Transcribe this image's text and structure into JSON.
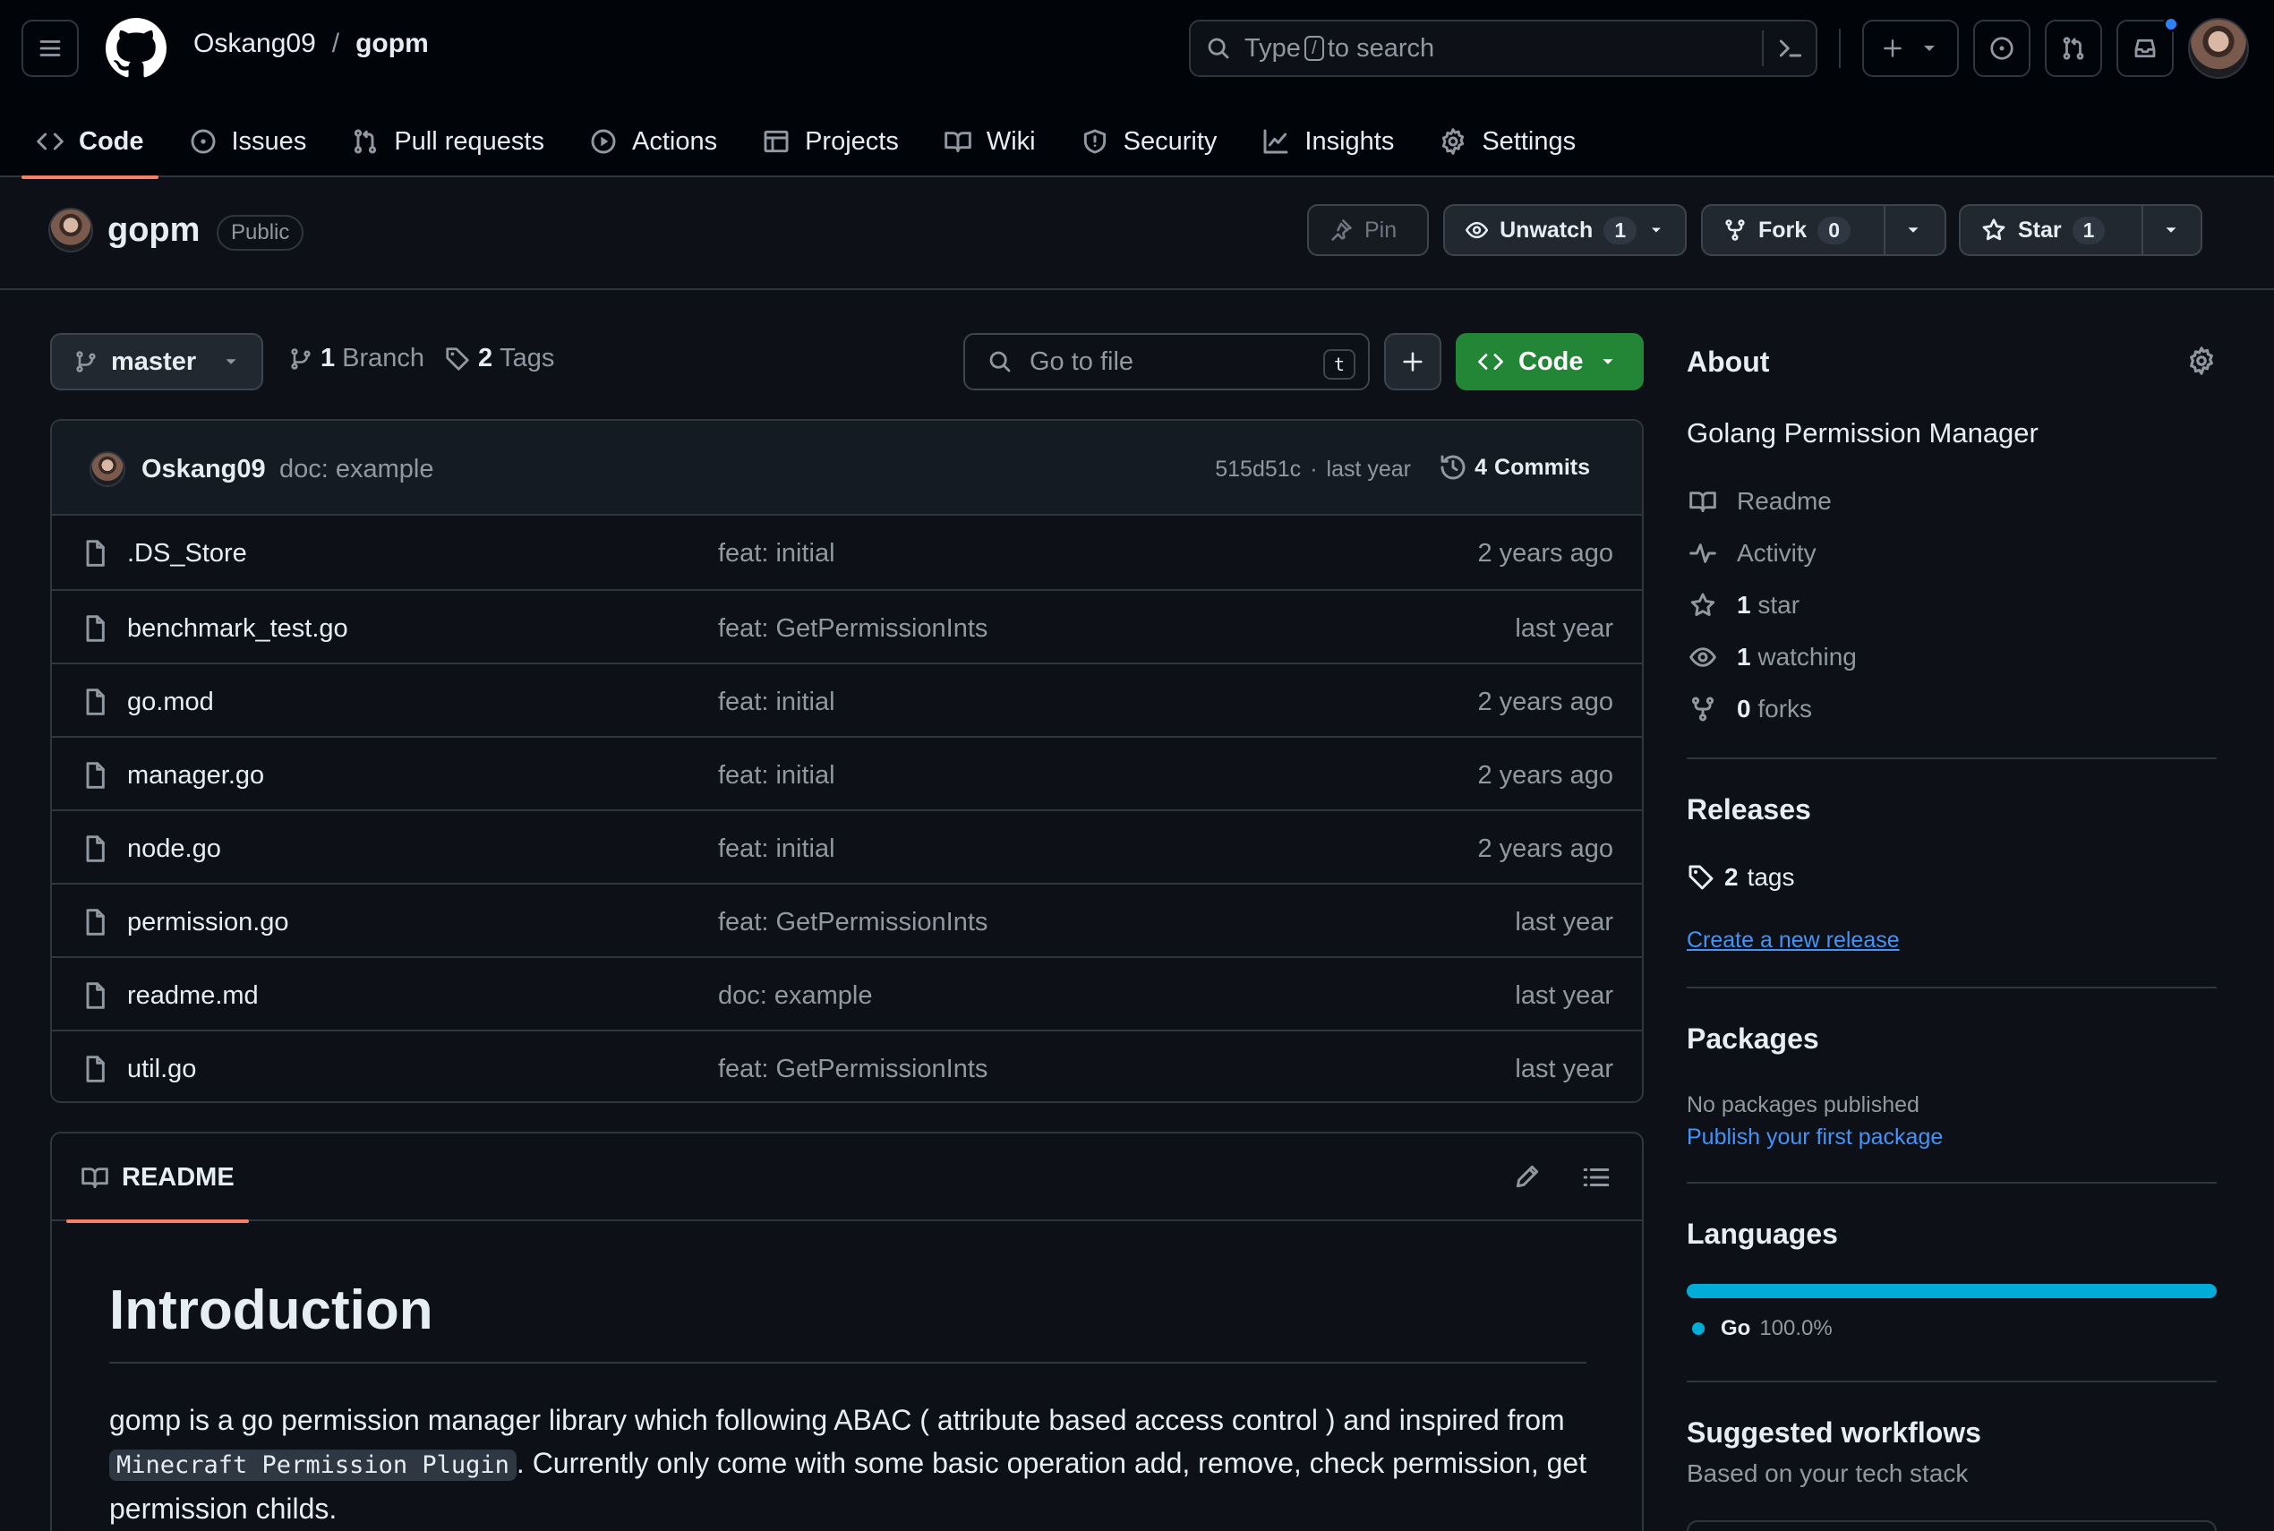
{
  "header": {
    "owner": "Oskang09",
    "separator": "/",
    "repo": "gopm",
    "search_prefix": "Type",
    "search_key": "/",
    "search_suffix": "to search"
  },
  "tabs": [
    {
      "label": "Code",
      "icon": "code-icon",
      "active": true
    },
    {
      "label": "Issues",
      "icon": "issue-icon"
    },
    {
      "label": "Pull requests",
      "icon": "pull-request-icon"
    },
    {
      "label": "Actions",
      "icon": "play-icon"
    },
    {
      "label": "Projects",
      "icon": "table-icon"
    },
    {
      "label": "Wiki",
      "icon": "book-icon"
    },
    {
      "label": "Security",
      "icon": "shield-icon"
    },
    {
      "label": "Insights",
      "icon": "graph-icon"
    },
    {
      "label": "Settings",
      "icon": "gear-icon"
    }
  ],
  "repo": {
    "name": "gopm",
    "visibility": "Public",
    "pin_label": "Pin",
    "watch_label": "Unwatch",
    "watch_count": "1",
    "fork_label": "Fork",
    "fork_count": "0",
    "star_label": "Star",
    "star_count": "1"
  },
  "toolbar": {
    "branch": "master",
    "branch_count": "1",
    "branch_label": "Branch",
    "tag_count": "2",
    "tag_label": "Tags",
    "go_to_file": "Go to file",
    "go_to_file_key": "t",
    "code_label": "Code"
  },
  "latest_commit": {
    "author": "Oskang09",
    "message": "doc: example",
    "sha": "515d51c",
    "dot": "·",
    "time": "last year",
    "commits_count": "4",
    "commits_label": "Commits"
  },
  "files": [
    {
      "name": ".DS_Store",
      "message": "feat: initial",
      "time": "2 years ago"
    },
    {
      "name": "benchmark_test.go",
      "message": "feat: GetPermissionInts",
      "time": "last year"
    },
    {
      "name": "go.mod",
      "message": "feat: initial",
      "time": "2 years ago"
    },
    {
      "name": "manager.go",
      "message": "feat: initial",
      "time": "2 years ago"
    },
    {
      "name": "node.go",
      "message": "feat: initial",
      "time": "2 years ago"
    },
    {
      "name": "permission.go",
      "message": "feat: GetPermissionInts",
      "time": "last year"
    },
    {
      "name": "readme.md",
      "message": "doc: example",
      "time": "last year"
    },
    {
      "name": "util.go",
      "message": "feat: GetPermissionInts",
      "time": "last year"
    }
  ],
  "readme": {
    "tab_label": "README",
    "title": "Introduction",
    "body_part1": "gomp is a go permission manager library which following ABAC ( attribute based access control ) and inspired from ",
    "body_code": "Minecraft Permission Plugin",
    "body_part2": ". Currently only come with some basic operation add, remove, check permission, get permission childs."
  },
  "sidebar": {
    "about_title": "About",
    "description": "Golang Permission Manager",
    "readme_label": "Readme",
    "activity_label": "Activity",
    "stars_count": "1",
    "stars_label": "star",
    "watching_count": "1",
    "watching_label": "watching",
    "forks_count": "0",
    "forks_label": "forks",
    "releases_title": "Releases",
    "tags_count": "2",
    "tags_label": "tags",
    "create_release": "Create a new release",
    "packages_title": "Packages",
    "no_packages": "No packages published",
    "publish_package": "Publish your first package",
    "languages_title": "Languages",
    "language_name": "Go",
    "language_percent": "100.0%",
    "language_share": 1.0,
    "language_color": "#00ADD8",
    "workflows_title": "Suggested workflows",
    "workflows_sub": "Based on your tech stack"
  },
  "colors": {
    "accent_tab": "#f78166",
    "code_button": "#238636",
    "link": "#4493f8",
    "notification": "#2f81f7"
  }
}
